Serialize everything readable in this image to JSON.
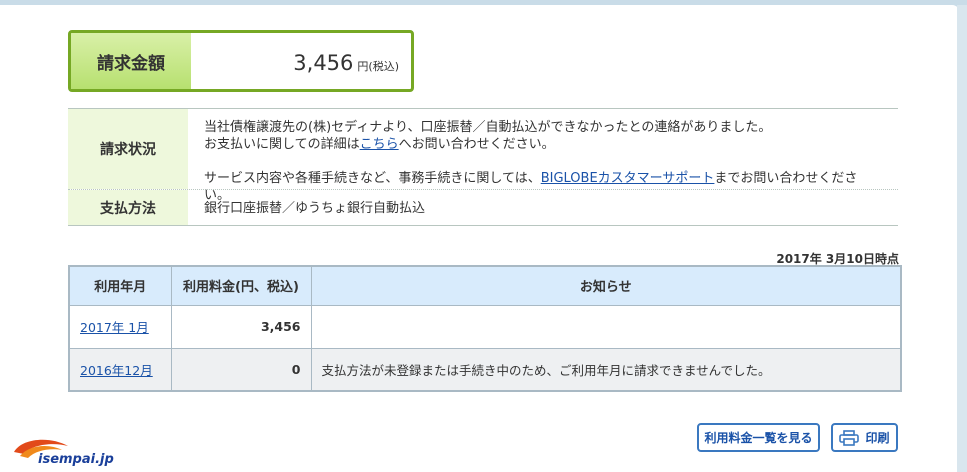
{
  "billing": {
    "label": "請求金額",
    "amount": "3,456",
    "unit": "円(税込)"
  },
  "info": {
    "status_label": "請求状況",
    "status_line1": "当社債権譲渡先の(株)セディナより、口座振替／自動払込ができなかったとの連絡がありました。",
    "status_line2_pre": "お支払いに関しての詳細は",
    "status_line2_link": "こちら",
    "status_line2_post": "へお問い合わせください。",
    "status_line3_pre": "サービス内容や各種手続きなど、事務手続きに関しては、",
    "status_line3_link": "BIGLOBEカスタマーサポート",
    "status_line3_post": "までお問い合わせください。",
    "method_label": "支払方法",
    "method_value": "銀行口座振替／ゆうちょ銀行自動払込"
  },
  "timestamp": "2017年 3月10日時点",
  "usage_table": {
    "headers": [
      "利用年月",
      "利用料金(円、税込)",
      "お知らせ"
    ],
    "rows": [
      {
        "month": "2017年 1月",
        "amount": "3,456",
        "notice": ""
      },
      {
        "month": "2016年12月",
        "amount": "0",
        "notice": "支払方法が未登録または手続き中のため、ご利用年月に請求できませんでした。"
      }
    ]
  },
  "buttons": {
    "list_label": "利用料金一覧を見る",
    "print_label": "印刷"
  },
  "logo": {
    "text": "isempai.jp"
  },
  "colors": {
    "accent_green": "#76a824",
    "link_blue": "#1a52a8",
    "header_blue": "#d8ebfc"
  }
}
